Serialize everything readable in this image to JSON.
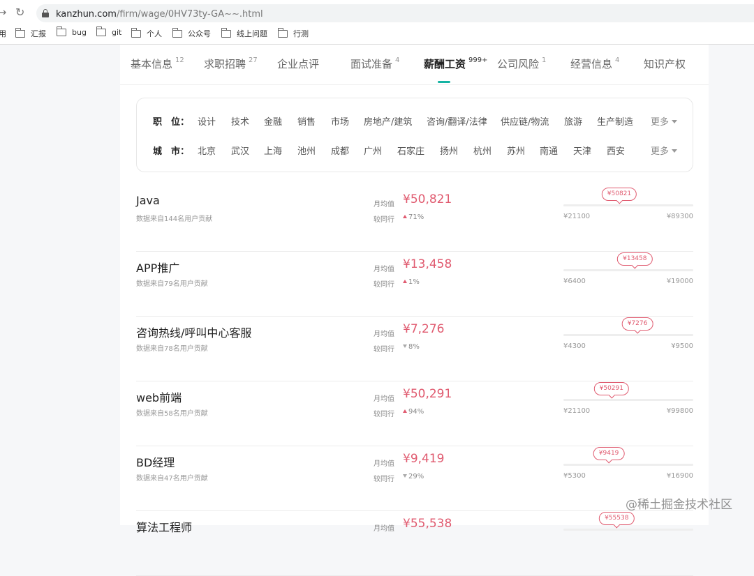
{
  "browser": {
    "url_host": "kanzhun.com",
    "url_path": "/firm/wage/0HV73ty-GA~~.html",
    "bookmarks": [
      {
        "label": "用"
      },
      {
        "label": "汇报"
      },
      {
        "label": "bug"
      },
      {
        "label": "git"
      },
      {
        "label": "个人"
      },
      {
        "label": "公众号"
      },
      {
        "label": "线上问题"
      },
      {
        "label": "行测"
      }
    ]
  },
  "tabs": [
    {
      "label": "基本信息",
      "count": "12"
    },
    {
      "label": "求职招聘",
      "count": "27"
    },
    {
      "label": "企业点评",
      "count": ""
    },
    {
      "label": "面试准备",
      "count": "4"
    },
    {
      "label": "薪酬工资",
      "count": "999+",
      "active": true
    },
    {
      "label": "公司风险",
      "count": "1"
    },
    {
      "label": "经营信息",
      "count": "4"
    },
    {
      "label": "知识产权",
      "count": ""
    }
  ],
  "filters": {
    "position": {
      "label": "职　位：",
      "options": [
        "设计",
        "技术",
        "金融",
        "销售",
        "市场",
        "房地产/建筑",
        "咨询/翻译/法律",
        "供应链/物流",
        "旅游",
        "生产制造"
      ],
      "more": "更多"
    },
    "city": {
      "label": "城　市：",
      "options": [
        "北京",
        "武汉",
        "上海",
        "池州",
        "成都",
        "广州",
        "石家庄",
        "扬州",
        "杭州",
        "苏州",
        "南通",
        "天津",
        "西安"
      ],
      "more": "更多"
    }
  },
  "labels": {
    "avg": "月均值",
    "compare": "较同行"
  },
  "jobs": [
    {
      "title": "Java",
      "source": "数据来自144名用户贡献",
      "avg": "¥50,821",
      "compare": "71%",
      "trend": "up",
      "bubble": "¥50821",
      "min": "¥21100",
      "max": "¥89300",
      "position": 0.43
    },
    {
      "title": "APP推广",
      "source": "数据来自79名用户贡献",
      "avg": "¥13,458",
      "compare": "1%",
      "trend": "up",
      "bubble": "¥13458",
      "min": "¥6400",
      "max": "¥19000",
      "position": 0.55
    },
    {
      "title": "咨询热线/呼叫中心客服",
      "source": "数据来自78名用户贡献",
      "avg": "¥7,276",
      "compare": "8%",
      "trend": "down",
      "bubble": "¥7276",
      "min": "¥4300",
      "max": "¥9500",
      "position": 0.57
    },
    {
      "title": "web前端",
      "source": "数据来自58名用户贡献",
      "avg": "¥50,291",
      "compare": "94%",
      "trend": "up",
      "bubble": "¥50291",
      "min": "¥21100",
      "max": "¥99800",
      "position": 0.37
    },
    {
      "title": "BD经理",
      "source": "数据来自47名用户贡献",
      "avg": "¥9,419",
      "compare": "29%",
      "trend": "down",
      "bubble": "¥9419",
      "min": "¥5300",
      "max": "¥16900",
      "position": 0.35
    },
    {
      "title": "算法工程师",
      "source": "",
      "avg": "¥55,538",
      "compare": "",
      "trend": "",
      "bubble": "¥55538",
      "min": "",
      "max": "",
      "position": 0.41
    }
  ],
  "watermark": "@稀土掘金技术社区"
}
